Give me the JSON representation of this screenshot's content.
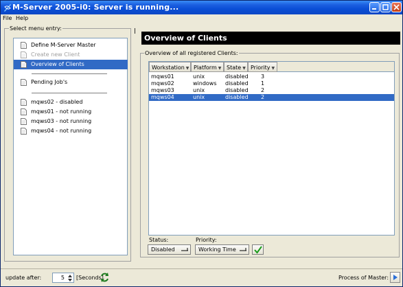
{
  "window": {
    "title": "M-Server 2005-i0: Server is running...",
    "accent": "#0a4ed6"
  },
  "menu": [
    {
      "label": "File"
    },
    {
      "label": "Help"
    }
  ],
  "left_panel": {
    "legend": "Select menu entry:",
    "items": [
      {
        "label": "Define M-Server Master",
        "state": "normal"
      },
      {
        "label": "Create new Client",
        "state": "disabled"
      },
      {
        "label": "Overview of Clients",
        "state": "selected"
      },
      {
        "label": "Pending Job's",
        "state": "normal"
      },
      {
        "label": "mqws02 - disabled",
        "state": "normal"
      },
      {
        "label": "mqws01 - not running",
        "state": "normal"
      },
      {
        "label": "mqws03 - not running",
        "state": "normal"
      },
      {
        "label": "mqws04 - not running",
        "state": "normal"
      }
    ],
    "selection_color": "#316ac5"
  },
  "main": {
    "header": "Overview of Clients",
    "group_legend": "Overview of all registered Clients:",
    "table": {
      "columns": [
        "Workstation",
        "Platform",
        "State",
        "Priority"
      ],
      "rows": [
        {
          "workstation": "mqws01",
          "platform": "unix",
          "state": "disabled",
          "priority": "3",
          "selected": false
        },
        {
          "workstation": "mqws02",
          "platform": "windows",
          "state": "disabled",
          "priority": "1",
          "selected": false
        },
        {
          "workstation": "mqws03",
          "platform": "unix",
          "state": "disabled",
          "priority": "2",
          "selected": false
        },
        {
          "workstation": "mqws04",
          "platform": "unix",
          "state": "disabled",
          "priority": "2",
          "selected": true
        }
      ]
    },
    "status_label": "Status:",
    "status_value": "Disabled",
    "priority_label": "Priority:",
    "priority_value": "Working Time"
  },
  "statusbar": {
    "update_label": "update after:",
    "update_value": "5",
    "unit_label": "[Seconds]",
    "process_label": "Process of Master:"
  },
  "icons": {
    "app": "app-icon",
    "doc": "document-icon",
    "ok": "checkmark-icon",
    "refresh": "refresh-icon",
    "play": "play-icon"
  }
}
